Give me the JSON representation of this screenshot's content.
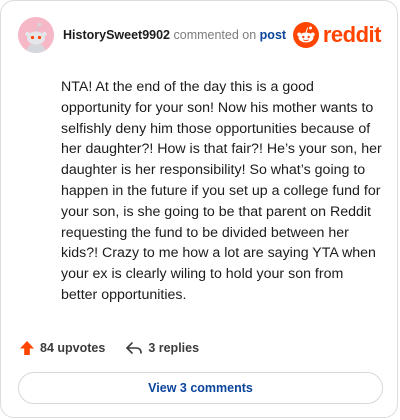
{
  "header": {
    "username": "HistorySweet9902",
    "commented_text": "commented on",
    "post_link": "post",
    "brand": "reddit",
    "brand_color": "#ff4500"
  },
  "comment": {
    "text": "NTA! At the end of the day this is a good opportunity for your son! Now his mother wants to selfishly deny him those opportunities because of her daughter?! How is that fair?! He’s your son, her daughter is her responsibility! So what’s going to happen in the future if you set up a college fund for your son, is she going to be that parent on Reddit requesting the fund to be divided between her kids?! Crazy to me how a lot are saying YTA when your ex is clearly wiling to hold your son from better opportunities."
  },
  "actions": {
    "upvotes": "84 upvotes",
    "replies": "3 replies",
    "upvote_icon": "upvote-arrow-icon",
    "reply_icon": "reply-arrow-icon"
  },
  "footer": {
    "view_comments": "View 3 comments"
  }
}
